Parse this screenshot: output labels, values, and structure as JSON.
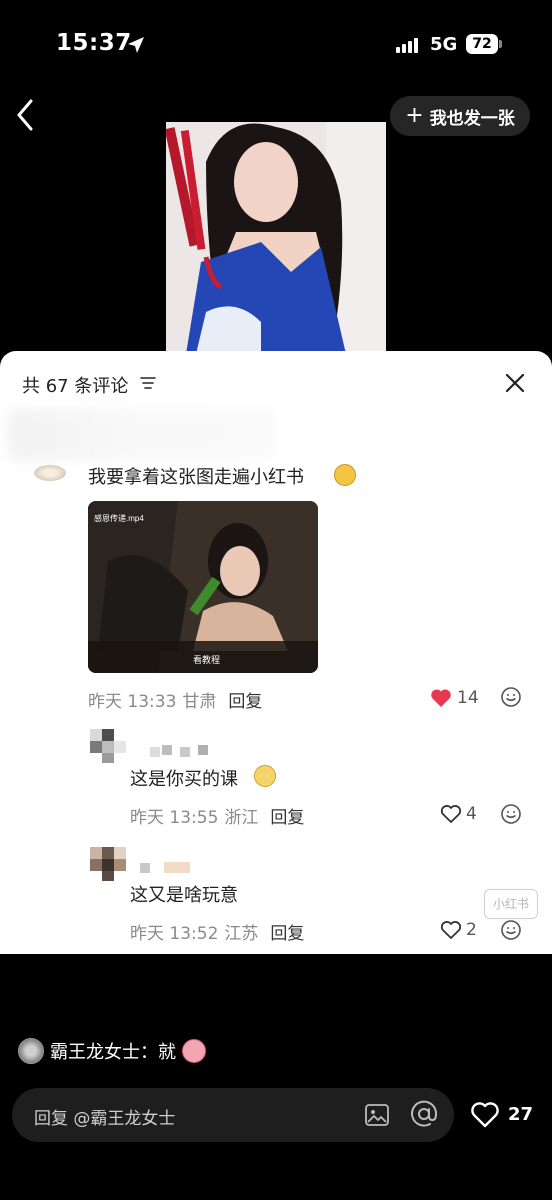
{
  "status": {
    "time": "15:37",
    "network": "5G",
    "battery": "72"
  },
  "nav": {
    "post_label": "我也发一张"
  },
  "comments": {
    "title": "共 67 条评论",
    "main": {
      "text": "我要拿着这张图走遍小红书",
      "time": "昨天 13:33",
      "location": "甘肃",
      "reply_label": "回复",
      "likes": "14"
    },
    "replies": [
      {
        "text": "这是你买的课",
        "time": "昨天 13:55",
        "location": "浙江",
        "reply_label": "回复",
        "likes": "4"
      },
      {
        "text": "这又是啥玩意",
        "time": "昨天 13:52",
        "location": "江苏",
        "reply_label": "回复",
        "likes": "2"
      }
    ],
    "watermark": "小红书"
  },
  "bottom": {
    "reply_user": "霸王龙女士：就",
    "input_placeholder": "回复 @霸王龙女士",
    "likes": "27"
  },
  "colors": {
    "like_red": "#e8384f",
    "sheet_bg": "#ffffff",
    "page_bg": "#000000"
  },
  "icons": [
    "arrow-location-icon",
    "signal-icon",
    "battery-icon",
    "back-chevron-icon",
    "plus-icon",
    "filter-icon",
    "close-icon",
    "heart-filled-icon",
    "heart-outline-icon",
    "emoji-face-icon",
    "image-icon",
    "at-icon"
  ]
}
